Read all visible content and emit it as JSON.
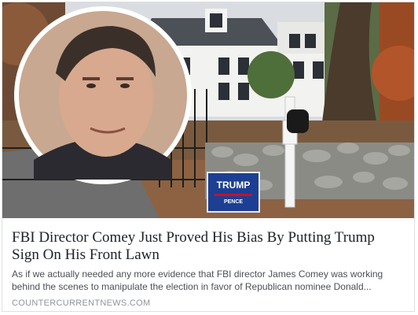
{
  "link_preview": {
    "headline": "FBI Director Comey Just Proved His Bias By Putting Trump Sign On His Front Lawn",
    "description": "As if we actually needed any more evidence that FBI director James Comey was working behind the scenes to manipulate the election in favor of Republican nominee Donald...",
    "domain": "COUNTERCURRENTNEWS.COM"
  },
  "sign": {
    "line1": "TRUMP",
    "line2": "PENCE"
  },
  "colors": {
    "headline": "#1d2129",
    "description": "#4b4f56",
    "domain": "#90949c",
    "sign_blue": "#1c3f94",
    "sign_red": "#c8102e"
  },
  "icons": {
    "mailbox": "mailbox-icon",
    "portrait": "portrait-photo"
  }
}
